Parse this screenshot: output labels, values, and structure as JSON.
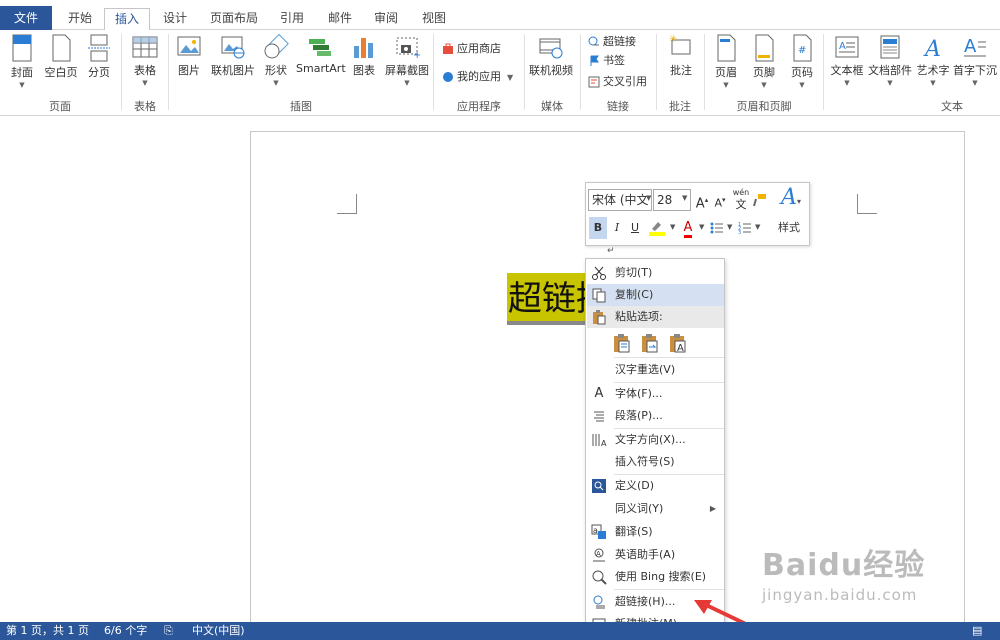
{
  "tabs": [
    "文件",
    "开始",
    "插入",
    "设计",
    "页面布局",
    "引用",
    "邮件",
    "审阅",
    "视图"
  ],
  "ribbon": {
    "page_group": {
      "label": "页面",
      "buttons": [
        "封面",
        "空白页",
        "分页"
      ]
    },
    "table_group": {
      "label": "表格",
      "buttons": [
        "表格"
      ]
    },
    "illustration_group": {
      "label": "插图",
      "buttons": [
        "图片",
        "联机图片",
        "形状",
        "SmartArt",
        "图表",
        "屏幕截图"
      ]
    },
    "apps_group": {
      "label": "应用程序",
      "store": "应用商店",
      "myapps": "我的应用"
    },
    "media_group": {
      "label": "媒体",
      "buttons": [
        "联机视频"
      ]
    },
    "links_group": {
      "label": "链接",
      "items": [
        "超链接",
        "书签",
        "交叉引用"
      ]
    },
    "comment_group": {
      "label": "批注",
      "buttons": [
        "批注"
      ]
    },
    "header_group": {
      "label": "页眉和页脚",
      "buttons": [
        "页眉",
        "页脚",
        "页码"
      ]
    },
    "text_group": {
      "label": "文本",
      "buttons": [
        "文本框",
        "文档部件",
        "艺术字",
        "首字下沉"
      ]
    }
  },
  "document": {
    "selected_text": "超链接"
  },
  "minibar": {
    "font_name": "宋体 (中文",
    "font_size": "28",
    "styles_label": "样式",
    "bold": "B",
    "italic": "I",
    "underline": "U",
    "grow": "A",
    "shrink": "A",
    "wen": "wén",
    "font_color": "A",
    "pinyin_mark": "↵"
  },
  "context_menu": {
    "items": [
      {
        "label": "剪切(T)",
        "icon": "scissors-icon"
      },
      {
        "label": "复制(C)",
        "icon": "copy-icon"
      },
      {
        "label": "粘贴选项:",
        "icon": "paste-icon"
      },
      {
        "label": "汉字重选(V)",
        "icon": ""
      },
      {
        "label": "字体(F)...",
        "icon": "font-icon"
      },
      {
        "label": "段落(P)...",
        "icon": "paragraph-icon"
      },
      {
        "label": "文字方向(X)...",
        "icon": "text-direction-icon"
      },
      {
        "label": "插入符号(S)",
        "icon": ""
      },
      {
        "label": "定义(D)",
        "icon": "define-icon"
      },
      {
        "label": "同义词(Y)",
        "icon": ""
      },
      {
        "label": "翻译(S)",
        "icon": "translate-icon"
      },
      {
        "label": "英语助手(A)",
        "icon": "english-assistant-icon"
      },
      {
        "label": "使用 Bing 搜索(E)",
        "icon": "bing-search-icon"
      },
      {
        "label": "超链接(H)...",
        "icon": "hyperlink-icon"
      },
      {
        "label": "新建批注(M)",
        "icon": "new-comment-icon"
      }
    ]
  },
  "status": {
    "page": "第 1 页，共 1 页",
    "words": "6/6 个字",
    "lang": "中文(中国)"
  },
  "watermark": {
    "brand": "Baidu经验",
    "url": "jingyan.baidu.com"
  },
  "colors": {
    "accent": "#2b579a",
    "highlight": "#c9c400",
    "hover": "#d5e1f2"
  }
}
